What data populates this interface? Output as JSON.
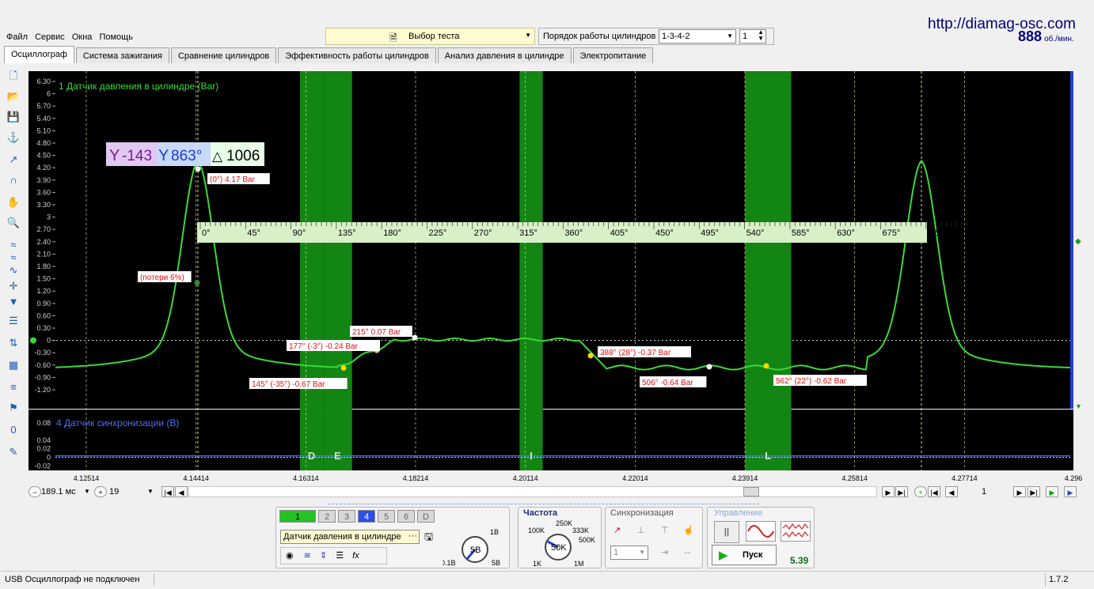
{
  "menu": [
    "Файл",
    "Сервис",
    "Окна",
    "Помощь"
  ],
  "test_select": {
    "label": "Выбор теста"
  },
  "firing_order": {
    "label": "Порядок работы цилиндров",
    "value": "1-3-4-2",
    "cylinder": "1"
  },
  "website": "http://diamag-osc.com",
  "rpm": {
    "value": "888",
    "unit": "об./мин."
  },
  "tabs": [
    "Осциллограф",
    "Система зажигания",
    "Сравнение цилиндров",
    "Эффективность работы цилиндров",
    "Анализ давления в цилиндре",
    "Электропитание"
  ],
  "toolbar_icons": [
    "new-file-icon",
    "open-folder-icon",
    "save-icon",
    "auto-scale-icon",
    "cursor-icon",
    "measure-icon",
    "hand-icon",
    "zoom-icon",
    "wave-icon",
    "wave2-icon",
    "wave3-icon",
    "crosshair-icon",
    "markers-icon",
    "compare-icon",
    "invert-icon",
    "table-icon",
    "auto-icon",
    "flag-icon",
    "zero-icon",
    "notes-icon"
  ],
  "scope": {
    "upper_channel_title": "1 Датчик давления в цилиндре (Bar)",
    "lower_channel_title": "4 Датчик синхронизации (В)",
    "upper_y_ticks": [
      "6.30",
      "6",
      "5.70",
      "5.40",
      "5.10",
      "4.80",
      "4.50",
      "4.20",
      "3.90",
      "3.60",
      "3.30",
      "3",
      "2.70",
      "2.40",
      "2.10",
      "1.80",
      "1.50",
      "1.20",
      "0.90",
      "0.60",
      "0.30",
      "0",
      "-0.30",
      "-0.60",
      "-0.90",
      "-1.20"
    ],
    "lower_y_ticks": [
      "0.08",
      "0.04",
      "0.02",
      "0",
      "-0.02"
    ],
    "x_ticks": [
      "4.12514",
      "4.14414",
      "4.16314",
      "4.18214",
      "4.20114",
      "4.22014",
      "4.23914",
      "4.25814",
      "4.27714",
      "4.296"
    ],
    "degree_ticks": [
      "0°",
      "45°",
      "90°",
      "135°",
      "180°",
      "225°",
      "270°",
      "315°",
      "360°",
      "405°",
      "450°",
      "495°",
      "540°",
      "585°",
      "630°",
      "675°",
      "720°"
    ],
    "markers": {
      "cursor1": "-143",
      "cursor2": "863°",
      "delta": "1006"
    },
    "annotations": [
      "(0°) 4.17 Bar",
      "(потери 6%)",
      "215° 0.07 Bar",
      "177° (-3°) -0.24 Bar",
      "145° (-35°) -0.67 Bar",
      "388° (28°) -0.37 Bar",
      "506° -0.64 Bar",
      "562° (22°) -0.62 Bar"
    ],
    "zone_labels": [
      "D",
      "E",
      "I",
      "L"
    ]
  },
  "bottom_nav": {
    "time": "189.1 мс",
    "zoom": "19",
    "page": "1"
  },
  "channel_panel": {
    "buttons": [
      "1",
      "2",
      "3",
      "4",
      "5",
      "6",
      "D"
    ],
    "sensor": "Датчик давления в цилиндре",
    "knob": "5В",
    "knob_min": "0.1В",
    "knob_max": "5В",
    "knob_mark": "1В"
  },
  "frequency_panel": {
    "title": "Частота",
    "labels": [
      "250K",
      "100K",
      "333K",
      "500K",
      "1K",
      "1M"
    ],
    "value": "50K"
  },
  "sync_panel": {
    "title": "Синхронизация",
    "channel": "1"
  },
  "control_panel": {
    "title": "Управление",
    "start": "Пуск",
    "value": "5.39"
  },
  "status": {
    "left": "USB Осциллограф не подключен",
    "version": "1.7.2"
  },
  "colors": {
    "bg": "#000000",
    "trace": "#3ad93a",
    "zone": "#138513",
    "grid": "#5a5a5a",
    "annot": "#e01010",
    "sync": "#4a6cff"
  }
}
